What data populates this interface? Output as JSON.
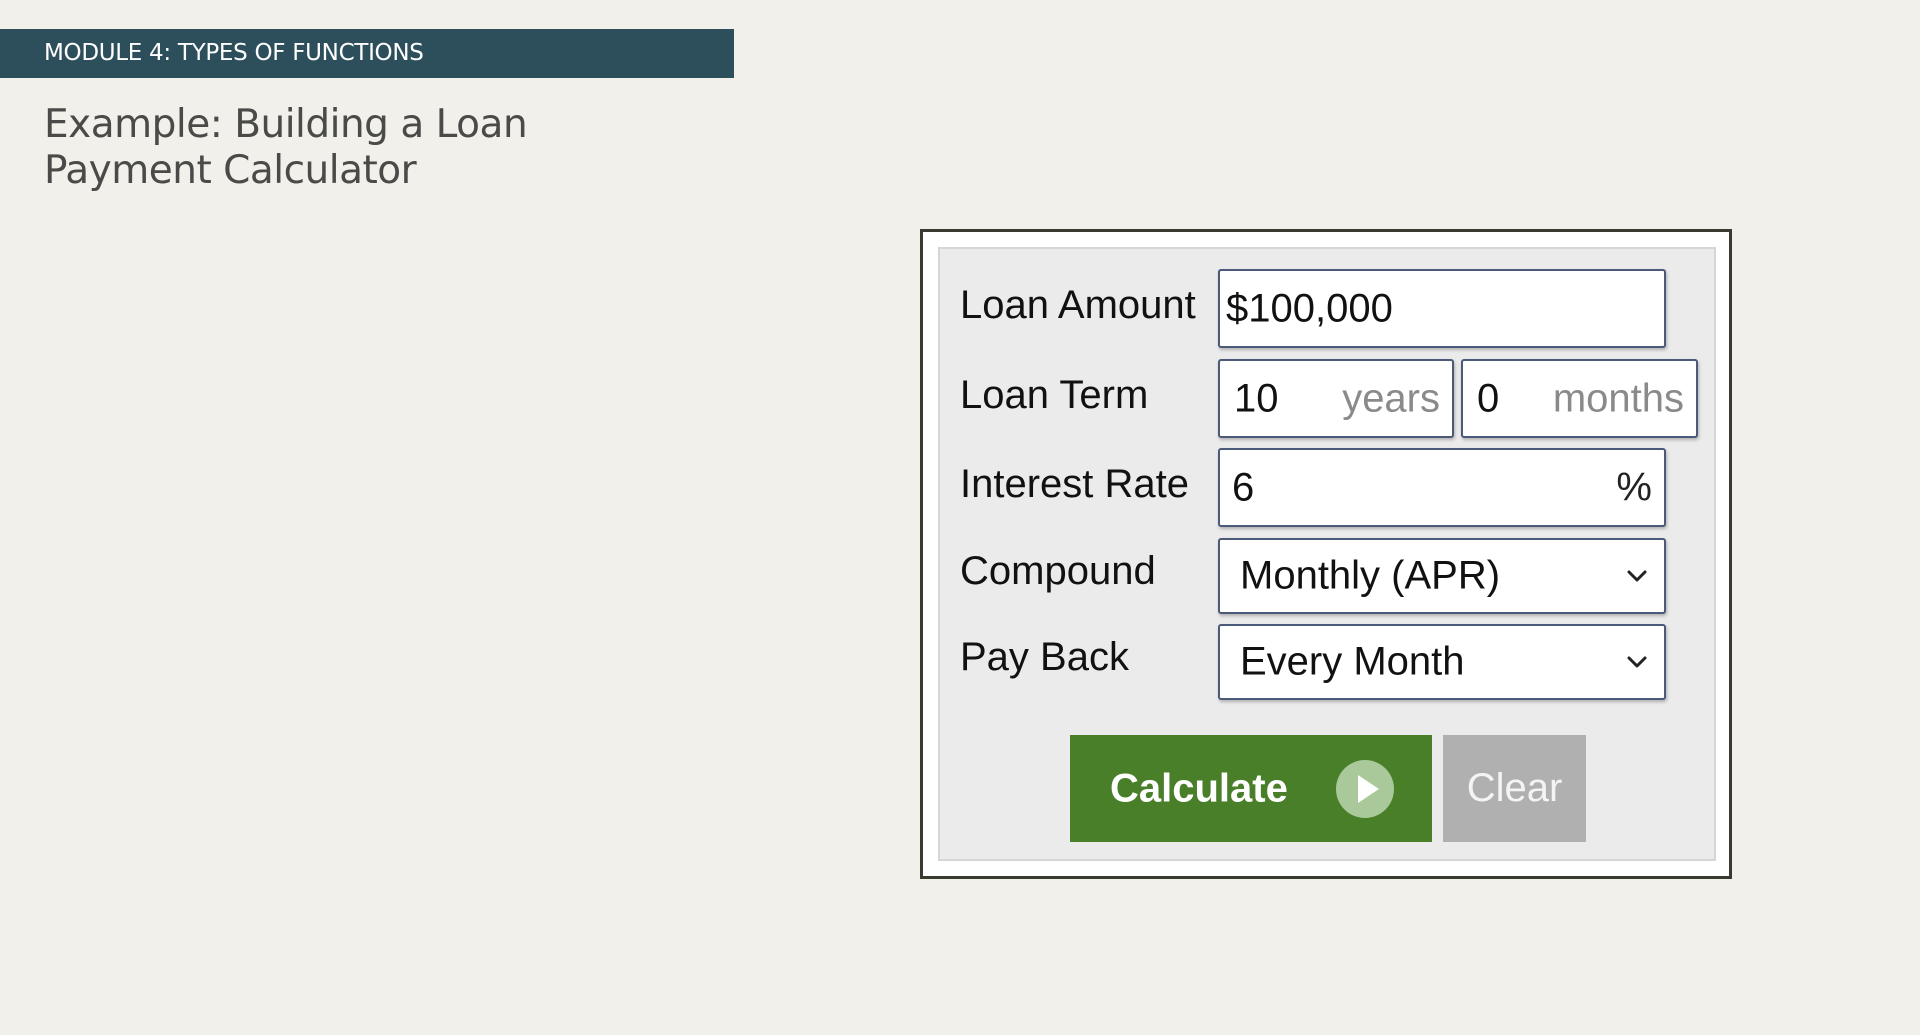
{
  "slide": {
    "module_label": "MODULE 4: TYPES OF FUNCTIONS",
    "title": "Example: Building a Loan Payment Calculator"
  },
  "calculator": {
    "loan_amount": {
      "label": "Loan Amount",
      "value": "$100,000"
    },
    "loan_term": {
      "label": "Loan Term",
      "years_value": "10",
      "years_unit": "years",
      "months_value": "0",
      "months_unit": "months"
    },
    "interest_rate": {
      "label": "Interest Rate",
      "value": "6",
      "unit": "%"
    },
    "compound": {
      "label": "Compound",
      "selected": "Monthly (APR)"
    },
    "pay_back": {
      "label": "Pay Back",
      "selected": "Every Month"
    },
    "buttons": {
      "calculate": "Calculate",
      "clear": "Clear"
    }
  },
  "icons": {
    "play": "play-circle-icon",
    "dropdown": "chevron-down-icon"
  },
  "colors": {
    "banner": "#2d4f5c",
    "calculate_button": "#4a7f2a",
    "clear_button": "#b0b0b0",
    "background": "#f2f0eb"
  }
}
